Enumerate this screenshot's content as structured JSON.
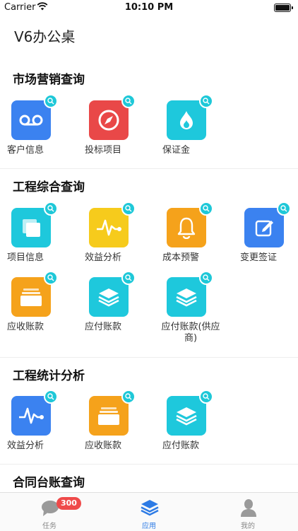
{
  "status_bar": {
    "carrier": "Carrier",
    "time": "10:10 PM"
  },
  "app_title": "V6办公桌",
  "sections": {
    "market": {
      "title": "市场营销查询",
      "items": [
        {
          "label": "客户信息",
          "color": "#3b82f0",
          "icon": "voicemail-icon"
        },
        {
          "label": "投标项目",
          "color": "#e94848",
          "icon": "compass-icon"
        },
        {
          "label": "保证金",
          "color": "#1ec8dc",
          "icon": "flame-icon"
        }
      ]
    },
    "engineering": {
      "title": "工程综合查询",
      "items": [
        {
          "label": "项目信息",
          "color": "#1ec8dc",
          "icon": "copy-icon"
        },
        {
          "label": "效益分析",
          "color": "#f6cb1c",
          "icon": "pulse-icon"
        },
        {
          "label": "成本预警",
          "color": "#f5a21b",
          "icon": "bell-icon"
        },
        {
          "label": "变更签证",
          "color": "#3b82f0",
          "icon": "edit-icon"
        },
        {
          "label": "应收账款",
          "color": "#f5a21b",
          "icon": "folder-icon"
        },
        {
          "label": "应付账款",
          "color": "#1ec8dc",
          "icon": "layers-icon"
        },
        {
          "label": "应付账款(供应商)",
          "color": "#1ec8dc",
          "icon": "layers-icon"
        }
      ]
    },
    "stats": {
      "title": "工程统计分析",
      "items": [
        {
          "label": "效益分析",
          "color": "#3b82f0",
          "icon": "pulse-icon"
        },
        {
          "label": "应收账款",
          "color": "#f5a21b",
          "icon": "folder-icon"
        },
        {
          "label": "应付账款",
          "color": "#1ec8dc",
          "icon": "layers-icon"
        }
      ]
    },
    "contract": {
      "title": "合同台账查询"
    }
  },
  "tabbar": {
    "tasks": {
      "label": "任务",
      "badge": "300"
    },
    "apps": {
      "label": "应用"
    },
    "mine": {
      "label": "我的"
    }
  },
  "colors": {
    "accent": "#2d7be5",
    "badge_red": "#ef4a4a",
    "search_badge": "#1ec8d8"
  }
}
